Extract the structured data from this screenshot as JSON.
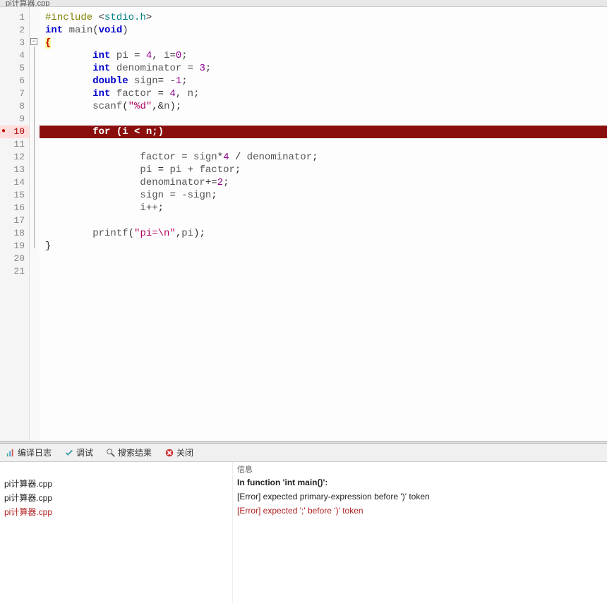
{
  "tab": {
    "title": "pi计算器.cpp"
  },
  "code": {
    "lines": [
      {
        "n": "1",
        "tokens": [
          [
            "pre",
            "#include "
          ],
          [
            "o",
            "<"
          ],
          [
            "t",
            "stdio.h"
          ],
          [
            "o",
            ">"
          ]
        ]
      },
      {
        "n": "2",
        "tokens": [
          [
            "k",
            "int"
          ],
          [
            "c",
            " main"
          ],
          [
            "o",
            "("
          ],
          [
            "k",
            "void"
          ],
          [
            "o",
            ")"
          ]
        ]
      },
      {
        "n": "3",
        "brace": true,
        "tokens": [
          [
            "brace-hl",
            "{"
          ]
        ]
      },
      {
        "n": "4",
        "indent": 2,
        "tokens": [
          [
            "k",
            "int"
          ],
          [
            "c",
            " pi "
          ],
          [
            "o",
            "="
          ],
          [
            "c",
            " "
          ],
          [
            "n",
            "4"
          ],
          [
            "o",
            ","
          ],
          [
            "c",
            " i"
          ],
          [
            "o",
            "="
          ],
          [
            "n",
            "0"
          ],
          [
            "o",
            ";"
          ]
        ]
      },
      {
        "n": "5",
        "indent": 2,
        "tokens": [
          [
            "k",
            "int"
          ],
          [
            "c",
            " denominator "
          ],
          [
            "o",
            "="
          ],
          [
            "c",
            " "
          ],
          [
            "n",
            "3"
          ],
          [
            "o",
            ";"
          ]
        ]
      },
      {
        "n": "6",
        "indent": 2,
        "tokens": [
          [
            "k",
            "double"
          ],
          [
            "c",
            " sign"
          ],
          [
            "o",
            "="
          ],
          [
            "c",
            " "
          ],
          [
            "o",
            "-"
          ],
          [
            "n",
            "1"
          ],
          [
            "o",
            ";"
          ]
        ]
      },
      {
        "n": "7",
        "indent": 2,
        "tokens": [
          [
            "k",
            "int"
          ],
          [
            "c",
            " factor "
          ],
          [
            "o",
            "="
          ],
          [
            "c",
            " "
          ],
          [
            "n",
            "4"
          ],
          [
            "o",
            ","
          ],
          [
            "c",
            " n"
          ],
          [
            "o",
            ";"
          ]
        ]
      },
      {
        "n": "8",
        "indent": 2,
        "tokens": [
          [
            "c",
            "scanf"
          ],
          [
            "o",
            "("
          ],
          [
            "s",
            "\"%d\""
          ],
          [
            "o",
            ","
          ],
          [
            "o",
            "&"
          ],
          [
            "c",
            "n"
          ],
          [
            "o",
            ")"
          ],
          [
            "o",
            ";"
          ]
        ]
      },
      {
        "n": "9",
        "tokens": []
      },
      {
        "n": "10",
        "err": true,
        "indent": 2,
        "text": "for (i < n;)"
      },
      {
        "n": "11",
        "tokens": []
      },
      {
        "n": "12",
        "indent": 4,
        "tokens": [
          [
            "c",
            "factor "
          ],
          [
            "o",
            "="
          ],
          [
            "c",
            " sign"
          ],
          [
            "o",
            "*"
          ],
          [
            "n",
            "4"
          ],
          [
            "c",
            " "
          ],
          [
            "o",
            "/"
          ],
          [
            "c",
            " denominator"
          ],
          [
            "o",
            ";"
          ]
        ]
      },
      {
        "n": "13",
        "indent": 4,
        "tokens": [
          [
            "c",
            "pi "
          ],
          [
            "o",
            "="
          ],
          [
            "c",
            " pi "
          ],
          [
            "o",
            "+"
          ],
          [
            "c",
            " factor"
          ],
          [
            "o",
            ";"
          ]
        ]
      },
      {
        "n": "14",
        "indent": 4,
        "tokens": [
          [
            "c",
            "denominator"
          ],
          [
            "o",
            "+="
          ],
          [
            "n",
            "2"
          ],
          [
            "o",
            ";"
          ]
        ]
      },
      {
        "n": "15",
        "indent": 4,
        "tokens": [
          [
            "c",
            "sign "
          ],
          [
            "o",
            "="
          ],
          [
            "c",
            " "
          ],
          [
            "o",
            "-"
          ],
          [
            "c",
            "sign"
          ],
          [
            "o",
            ";"
          ]
        ]
      },
      {
        "n": "16",
        "indent": 4,
        "tokens": [
          [
            "c",
            "i"
          ],
          [
            "o",
            "++"
          ],
          [
            "o",
            ";"
          ]
        ]
      },
      {
        "n": "17",
        "tokens": []
      },
      {
        "n": "18",
        "indent": 2,
        "tokens": [
          [
            "c",
            "printf"
          ],
          [
            "o",
            "("
          ],
          [
            "s",
            "\"pi=\\n\""
          ],
          [
            "o",
            ","
          ],
          [
            "c",
            "pi"
          ],
          [
            "o",
            ")"
          ],
          [
            "o",
            ";"
          ]
        ]
      },
      {
        "n": "19",
        "tokens": [
          [
            "o",
            "}"
          ]
        ]
      },
      {
        "n": "20",
        "tokens": []
      },
      {
        "n": "21",
        "tokens": []
      }
    ]
  },
  "output_tabs": {
    "compile_log": "编译日志",
    "debug": "调试",
    "search_results": "搜索结果",
    "close": "关闭"
  },
  "output_header": {
    "file": "",
    "message": "信息"
  },
  "errors": [
    {
      "file": "pi计算器.cpp",
      "msg": "In function 'int main()':",
      "bold": true
    },
    {
      "file": "pi计算器.cpp",
      "msg": "[Error] expected primary-expression before ')' token",
      "red": false
    },
    {
      "file": "pi计算器.cpp",
      "msg": "[Error] expected ';' before ')' token",
      "red": true
    }
  ]
}
